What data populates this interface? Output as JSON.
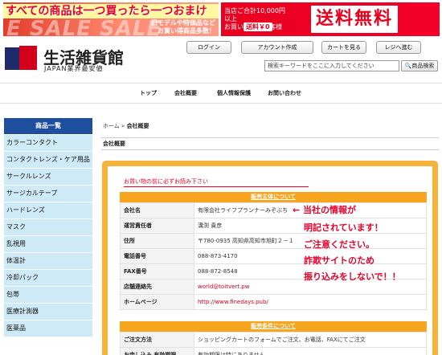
{
  "banner_left": {
    "headline": "すべての商品は一つ買ったら一つおまけ",
    "bg_text": "E SALE SALE",
    "sub_line1": "旧モデルや特価品など",
    "sub_line2": "お買い得商品多数！"
  },
  "banner_right": {
    "note_line1": "当店ご合計10,000円以上",
    "note_line2": "お買い上げのお客様",
    "chip": "送料￥0",
    "big": "送料無料"
  },
  "header": {
    "site_name": "生活雑貨館",
    "site_sub": "JAPAN業界最安値",
    "buttons": {
      "login": "ログイン",
      "account": "アカウント作成",
      "cart": "カートを見る",
      "checkout": "レジへ進む"
    },
    "search_placeholder": "検索キーワードをここに入力してください",
    "search_button": "商品検索"
  },
  "nav": {
    "top": "トップ",
    "company": "会社概要",
    "privacy": "個人情報保護",
    "contact": "お問い合わせ"
  },
  "sidebar": {
    "title": "商品一覧",
    "items": [
      "カラーコンタクト",
      "コンタクトレンズ・ケア用品",
      "サークルレンズ",
      "サージカルテープ",
      "ハードレンズ",
      "マスク",
      "乱視用",
      "体温計",
      "冷却パック",
      "包帯",
      "医療計測器",
      "医薬品"
    ]
  },
  "breadcrumb": {
    "home": "ホーム",
    "sep": "»",
    "current": "会社概要"
  },
  "page_title": "会社概要",
  "notice": "お買い物の前に必ずお読み下さい",
  "section1": "販売主体について",
  "section2": "販売条件について",
  "rows": [
    {
      "k": "会社名",
      "v": "有限会社ライフプランナーみぞぶち"
    },
    {
      "k": "運営責任者",
      "v": "溝渕 貴彦"
    },
    {
      "k": "住所",
      "v": "〒780-0935 高知県高知市旭町２－１"
    },
    {
      "k": "電話番号",
      "v": "088-873-4170"
    },
    {
      "k": "FAX番号",
      "v": "088-872-8548"
    },
    {
      "k": "店舗連絡先",
      "v": "world@toitvert.pw"
    },
    {
      "k": "ホームページ",
      "v": "http://www.finedays.pub/"
    }
  ],
  "rows2": [
    {
      "k": "ご注文方法",
      "v": "ショッピングカートのフォームでご注文、お電話、FAXにてご注文"
    },
    {
      "k": "お申し込み 有効期限",
      "v": "有効期限は特にありません。"
    }
  ],
  "overlay": {
    "line1": "← 当社の情報が",
    "line2": "明記されています！",
    "line3": "ご注意ください。",
    "line4": "詐欺サイトのため",
    "line5": "振り込みをしないで！！"
  }
}
